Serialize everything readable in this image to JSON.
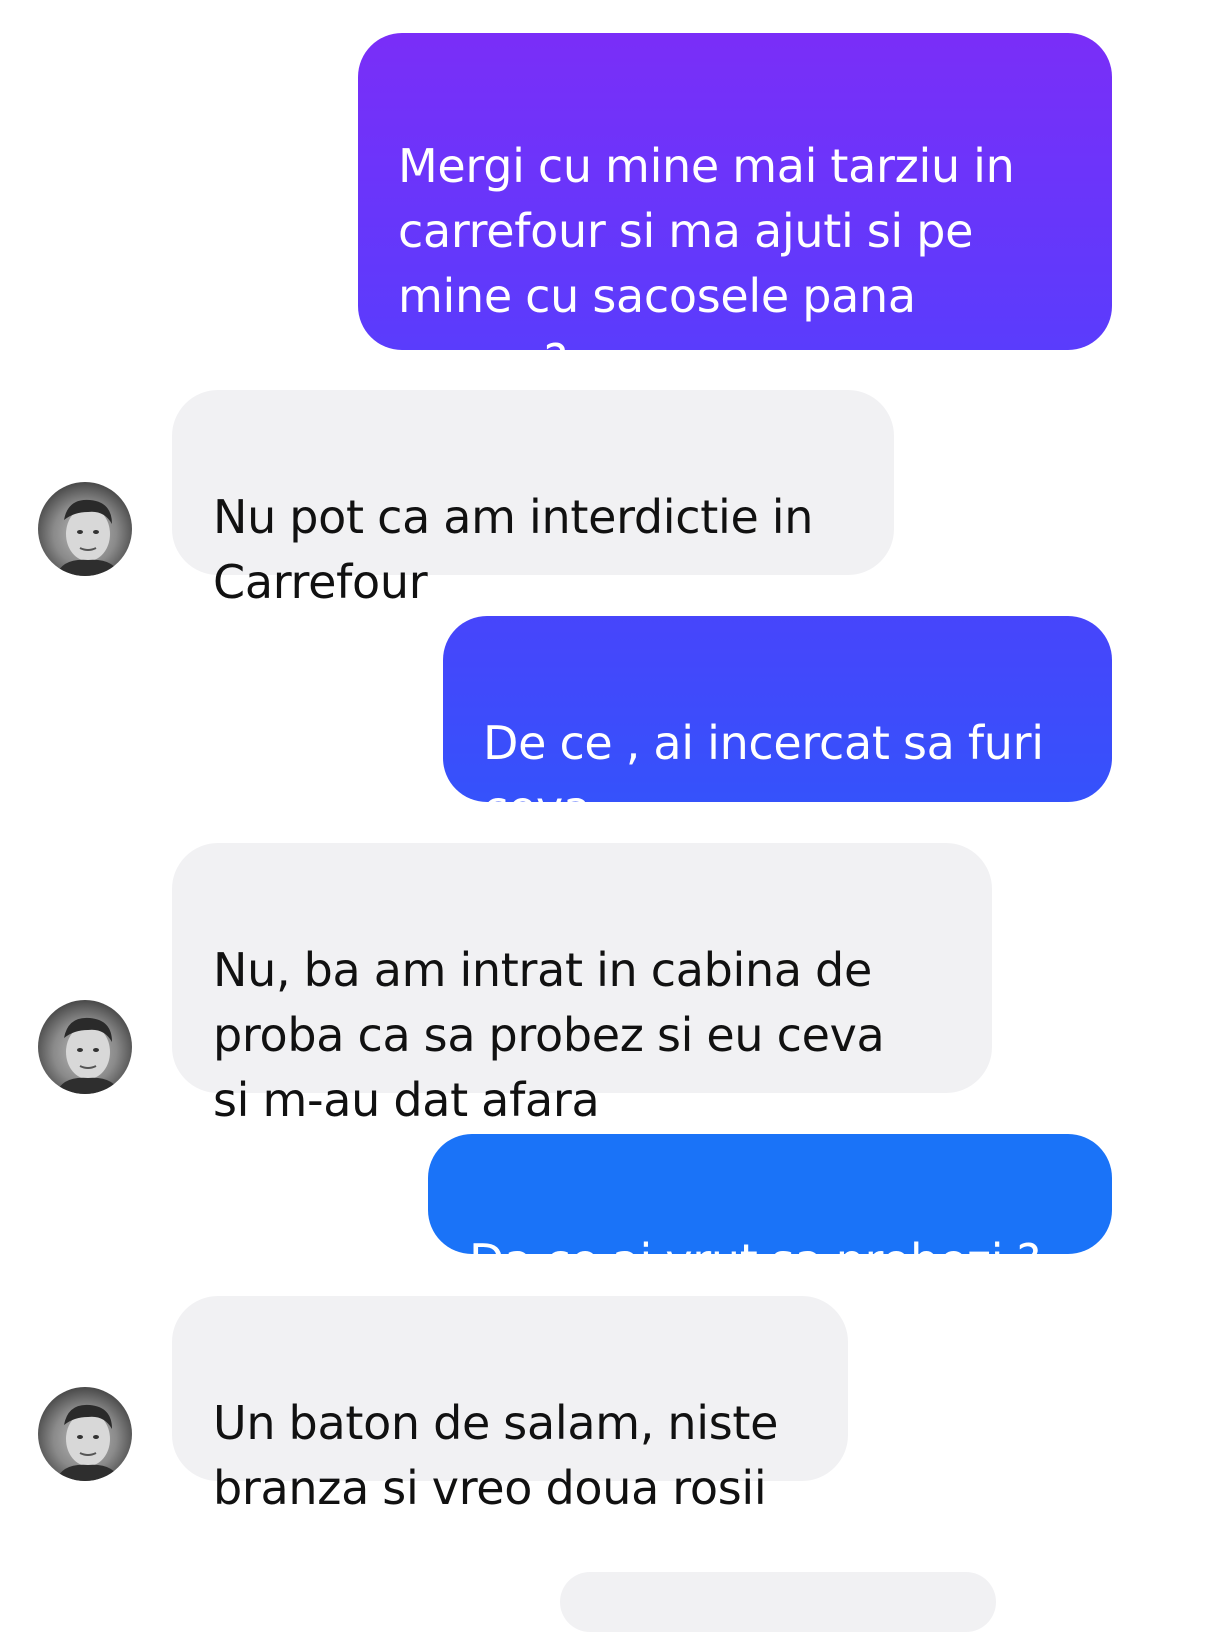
{
  "conversation": {
    "messages": [
      {
        "direction": "outgoing",
        "text": "Mergi cu mine mai tarziu in\ncarrefour si ma ajuti si pe\nmine cu sacosele pana\nacasa ?"
      },
      {
        "direction": "incoming",
        "text": "Nu pot ca am interdictie in\nCarrefour"
      },
      {
        "direction": "outgoing",
        "text": "De ce , ai incercat sa furi\nceva"
      },
      {
        "direction": "incoming",
        "text": "Nu, ba am intrat in cabina de\nproba ca sa probez si eu ceva\nsi m-au dat afara"
      },
      {
        "direction": "outgoing",
        "text": "Da ce ai vrut sa probezi ?"
      },
      {
        "direction": "incoming",
        "text": "Un baton de salam, niste\nbranza si vreo doua rosii"
      }
    ]
  },
  "colors": {
    "outgoing_gradient_top": "#7b2cf8",
    "outgoing_gradient_bottom": "#0a84ff",
    "incoming_bubble": "#f1f1f3",
    "incoming_text": "#111111",
    "outgoing_text": "#ffffff"
  },
  "icons": {
    "avatar": "contact-avatar-photo"
  }
}
